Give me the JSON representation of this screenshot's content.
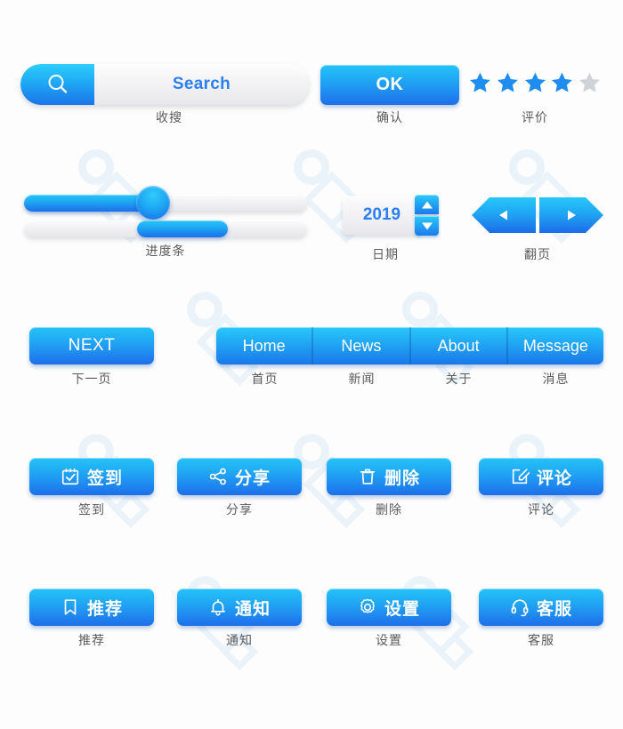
{
  "search": {
    "icon": "search-icon",
    "value": "Search",
    "caption": "收搜"
  },
  "confirm": {
    "label": "OK",
    "caption": "确认"
  },
  "rating": {
    "caption": "评价",
    "total": 5,
    "filled": 4,
    "filled_color": "#1f8df0",
    "empty_color": "#cfd2d6"
  },
  "progress": {
    "caption": "进度条",
    "bar1_percent": 47,
    "bar2_start_percent": 40,
    "bar2_end_percent": 72
  },
  "date": {
    "value": "2019",
    "caption": "日期",
    "up_icon": "triangle-up-icon",
    "down_icon": "triangle-down-icon"
  },
  "pager": {
    "caption": "翻页",
    "prev_icon": "triangle-left-icon",
    "next_icon": "triangle-right-icon"
  },
  "next": {
    "label": "NEXT",
    "caption": "下一页"
  },
  "nav": {
    "items": [
      {
        "label": "Home",
        "caption": "首页"
      },
      {
        "label": "News",
        "caption": "新闻"
      },
      {
        "label": "About",
        "caption": "关于"
      },
      {
        "label": "Message",
        "caption": "消息"
      }
    ]
  },
  "actions": [
    {
      "label": "签到",
      "caption": "签到",
      "icon": "checkbox-check-icon"
    },
    {
      "label": "分享",
      "caption": "分享",
      "icon": "share-nodes-icon"
    },
    {
      "label": "删除",
      "caption": "删除",
      "icon": "trash-icon"
    },
    {
      "label": "评论",
      "caption": "评论",
      "icon": "edit-square-icon"
    },
    {
      "label": "推荐",
      "caption": "推荐",
      "icon": "bookmark-icon"
    },
    {
      "label": "通知",
      "caption": "通知",
      "icon": "bell-icon"
    },
    {
      "label": "设置",
      "caption": "设置",
      "icon": "gear-icon"
    },
    {
      "label": "客服",
      "caption": "客服",
      "icon": "headset-icon"
    }
  ],
  "theme": {
    "accent_light": "#2ecdfb",
    "accent_dark": "#1b6fe8",
    "text_blue": "#2a7ff2",
    "caption_gray": "#5b5b5b"
  }
}
